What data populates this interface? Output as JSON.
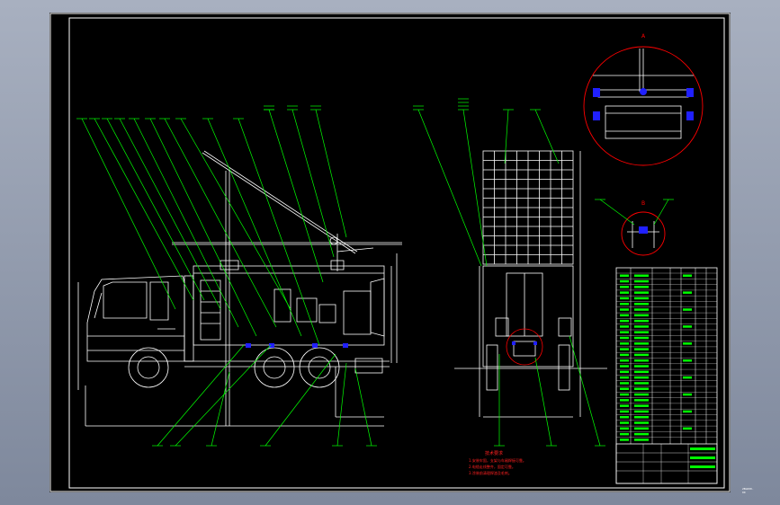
{
  "drawing": {
    "notes_title": "技术要求",
    "notes": [
      "1.安装牢固，支架与车厢焊接可靠。",
      "2.电缆走线整齐，固定可靠。",
      "3.涂装前清理焊渣及毛刺。"
    ],
    "detail_labels": [
      "A",
      "B"
    ],
    "drawing_number": "ZBG000-00"
  },
  "colors": {
    "background": "#000000",
    "outline": "#ffffff",
    "leader": "#00ff00",
    "detail_circle": "#ff0000",
    "section_fill": "#2020ff"
  }
}
